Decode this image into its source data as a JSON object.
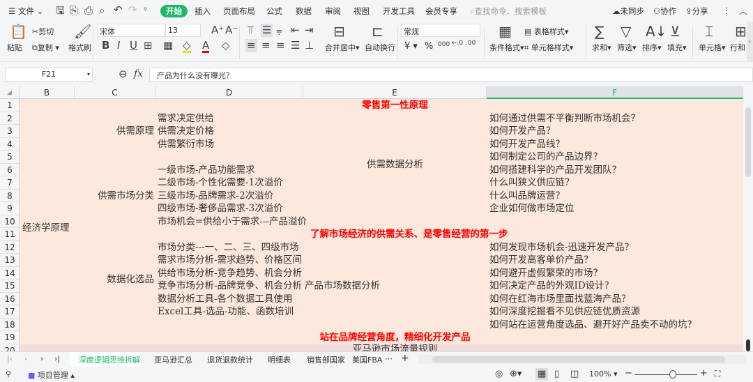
{
  "menu": {
    "file": "文件",
    "tabs": [
      "开始",
      "插入",
      "页面布局",
      "公式",
      "数据",
      "审阅",
      "视图",
      "开发工具",
      "会员专享"
    ],
    "search_placeholder": "查找命令、搜索模板",
    "sync": "未同步",
    "collab": "协作",
    "share": "分享"
  },
  "ribbon": {
    "paste": "粘贴",
    "cut": "剪切",
    "copy": "复制",
    "format_painter": "格式刷",
    "font": "宋体",
    "font_size": "13",
    "merge": "合并居中",
    "wrap": "自动换行",
    "number_format": "常规",
    "cond_format": "条件格式",
    "table_style": "表格样式",
    "cell_style": "单元格样式",
    "sum": "求和",
    "filter": "筛选",
    "sort": "排序",
    "fill": "填充",
    "cell": "单元格",
    "rowcol": "行和"
  },
  "formula": {
    "name_box": "F21",
    "fx": "fx",
    "value": "产品为什么没有曝光？"
  },
  "columns": [
    "B",
    "C",
    "D",
    "E",
    "F"
  ],
  "rows": [
    "1",
    "2",
    "3",
    "4",
    "5",
    "6",
    "7",
    "8",
    "9",
    "10",
    "11",
    "12",
    "13",
    "14",
    "15",
    "16",
    "17",
    "18",
    "19",
    "20"
  ],
  "cells": {
    "title": "零售第一性原理",
    "b_econ": "经济学原理",
    "c_supply": "供需原理",
    "c_market": "供需市场分类",
    "c_data": "数据化选品",
    "d": [
      "需求决定供给",
      "供需决定价格",
      "供需繁衍市场",
      "一级市场-产品功能需求",
      "二级市场-个性化需要-1次溢价",
      "三级市场-品牌需求-2次溢价",
      "四级市场-奢侈品需求-3次溢价",
      "市场机会=供给小于需求---产品溢价",
      "市场分类---一、二、三、四级市场",
      "需求市场分析-需求趋势、价格区间",
      "供给市场分析-竞争趋势、机会分析",
      "竞争市场分析-品牌竞争、机会分析",
      "数据分析工具-各个数据工具使用",
      "Excel工具-选品-功能、函数培训"
    ],
    "e_supply_analysis": "供需数据分析",
    "e_product_market": "产品市场数据分析",
    "row11": "了解市场经济的供需关系、是零售经营的第一步",
    "row19": "站在品牌经营角度，精细化开发产品",
    "row20": "亚马逊市场流量规则",
    "f": [
      "如何通过供需不平衡判断市场机会？",
      "如何开发产品？",
      "如何开发产品线？",
      "如何制定公司的产品边界？",
      "如何搭建科学的产品开发团队？",
      "什么叫狭义供应链？",
      "什么叫品牌运营？",
      "企业如何做市场定位",
      "如何发现市场机会-迅速开发产品？",
      "如何开发高客单价产品？",
      "如何避开虚假繁荣的市场？",
      "如何决定产品的外观ID设计？",
      "如何在红海市场里面找蓝海产品？",
      "如何深度挖掘看不见供应链优质资源",
      "如何站在运营角度选品、避开好产品卖不动的坑？"
    ]
  },
  "sheets": [
    "深度逻辑思维拆解",
    "亚马逊汇总",
    "退货退款统计",
    "明细表",
    "销售部国家",
    "美国FBA"
  ],
  "status": {
    "project": "项目管理",
    "zoom": "100%"
  },
  "colors": {
    "accent": "#1eb96a",
    "cell_bg": "#fce8dc",
    "row20_bg": "#f2dcdb",
    "red": "#ff0000"
  }
}
